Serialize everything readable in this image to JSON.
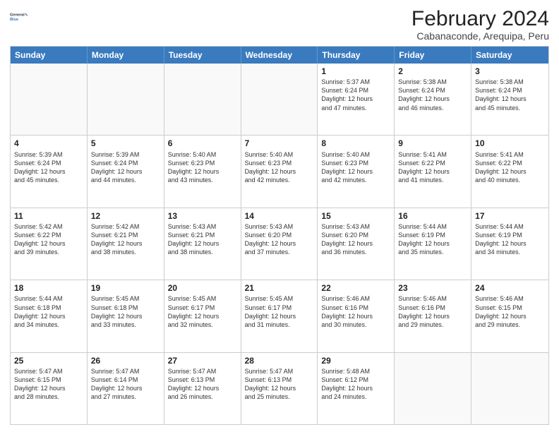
{
  "header": {
    "title": "February 2024",
    "subtitle": "Cabanaconde, Arequipa, Peru",
    "logo_general": "General",
    "logo_blue": "Blue"
  },
  "days_of_week": [
    "Sunday",
    "Monday",
    "Tuesday",
    "Wednesday",
    "Thursday",
    "Friday",
    "Saturday"
  ],
  "weeks": [
    [
      {
        "day": "",
        "text": "",
        "empty": true
      },
      {
        "day": "",
        "text": "",
        "empty": true
      },
      {
        "day": "",
        "text": "",
        "empty": true
      },
      {
        "day": "",
        "text": "",
        "empty": true
      },
      {
        "day": "1",
        "text": "Sunrise: 5:37 AM\nSunset: 6:24 PM\nDaylight: 12 hours\nand 47 minutes.",
        "empty": false
      },
      {
        "day": "2",
        "text": "Sunrise: 5:38 AM\nSunset: 6:24 PM\nDaylight: 12 hours\nand 46 minutes.",
        "empty": false
      },
      {
        "day": "3",
        "text": "Sunrise: 5:38 AM\nSunset: 6:24 PM\nDaylight: 12 hours\nand 45 minutes.",
        "empty": false
      }
    ],
    [
      {
        "day": "4",
        "text": "Sunrise: 5:39 AM\nSunset: 6:24 PM\nDaylight: 12 hours\nand 45 minutes.",
        "empty": false
      },
      {
        "day": "5",
        "text": "Sunrise: 5:39 AM\nSunset: 6:24 PM\nDaylight: 12 hours\nand 44 minutes.",
        "empty": false
      },
      {
        "day": "6",
        "text": "Sunrise: 5:40 AM\nSunset: 6:23 PM\nDaylight: 12 hours\nand 43 minutes.",
        "empty": false
      },
      {
        "day": "7",
        "text": "Sunrise: 5:40 AM\nSunset: 6:23 PM\nDaylight: 12 hours\nand 42 minutes.",
        "empty": false
      },
      {
        "day": "8",
        "text": "Sunrise: 5:40 AM\nSunset: 6:23 PM\nDaylight: 12 hours\nand 42 minutes.",
        "empty": false
      },
      {
        "day": "9",
        "text": "Sunrise: 5:41 AM\nSunset: 6:22 PM\nDaylight: 12 hours\nand 41 minutes.",
        "empty": false
      },
      {
        "day": "10",
        "text": "Sunrise: 5:41 AM\nSunset: 6:22 PM\nDaylight: 12 hours\nand 40 minutes.",
        "empty": false
      }
    ],
    [
      {
        "day": "11",
        "text": "Sunrise: 5:42 AM\nSunset: 6:22 PM\nDaylight: 12 hours\nand 39 minutes.",
        "empty": false
      },
      {
        "day": "12",
        "text": "Sunrise: 5:42 AM\nSunset: 6:21 PM\nDaylight: 12 hours\nand 38 minutes.",
        "empty": false
      },
      {
        "day": "13",
        "text": "Sunrise: 5:43 AM\nSunset: 6:21 PM\nDaylight: 12 hours\nand 38 minutes.",
        "empty": false
      },
      {
        "day": "14",
        "text": "Sunrise: 5:43 AM\nSunset: 6:20 PM\nDaylight: 12 hours\nand 37 minutes.",
        "empty": false
      },
      {
        "day": "15",
        "text": "Sunrise: 5:43 AM\nSunset: 6:20 PM\nDaylight: 12 hours\nand 36 minutes.",
        "empty": false
      },
      {
        "day": "16",
        "text": "Sunrise: 5:44 AM\nSunset: 6:19 PM\nDaylight: 12 hours\nand 35 minutes.",
        "empty": false
      },
      {
        "day": "17",
        "text": "Sunrise: 5:44 AM\nSunset: 6:19 PM\nDaylight: 12 hours\nand 34 minutes.",
        "empty": false
      }
    ],
    [
      {
        "day": "18",
        "text": "Sunrise: 5:44 AM\nSunset: 6:18 PM\nDaylight: 12 hours\nand 34 minutes.",
        "empty": false
      },
      {
        "day": "19",
        "text": "Sunrise: 5:45 AM\nSunset: 6:18 PM\nDaylight: 12 hours\nand 33 minutes.",
        "empty": false
      },
      {
        "day": "20",
        "text": "Sunrise: 5:45 AM\nSunset: 6:17 PM\nDaylight: 12 hours\nand 32 minutes.",
        "empty": false
      },
      {
        "day": "21",
        "text": "Sunrise: 5:45 AM\nSunset: 6:17 PM\nDaylight: 12 hours\nand 31 minutes.",
        "empty": false
      },
      {
        "day": "22",
        "text": "Sunrise: 5:46 AM\nSunset: 6:16 PM\nDaylight: 12 hours\nand 30 minutes.",
        "empty": false
      },
      {
        "day": "23",
        "text": "Sunrise: 5:46 AM\nSunset: 6:16 PM\nDaylight: 12 hours\nand 29 minutes.",
        "empty": false
      },
      {
        "day": "24",
        "text": "Sunrise: 5:46 AM\nSunset: 6:15 PM\nDaylight: 12 hours\nand 29 minutes.",
        "empty": false
      }
    ],
    [
      {
        "day": "25",
        "text": "Sunrise: 5:47 AM\nSunset: 6:15 PM\nDaylight: 12 hours\nand 28 minutes.",
        "empty": false
      },
      {
        "day": "26",
        "text": "Sunrise: 5:47 AM\nSunset: 6:14 PM\nDaylight: 12 hours\nand 27 minutes.",
        "empty": false
      },
      {
        "day": "27",
        "text": "Sunrise: 5:47 AM\nSunset: 6:13 PM\nDaylight: 12 hours\nand 26 minutes.",
        "empty": false
      },
      {
        "day": "28",
        "text": "Sunrise: 5:47 AM\nSunset: 6:13 PM\nDaylight: 12 hours\nand 25 minutes.",
        "empty": false
      },
      {
        "day": "29",
        "text": "Sunrise: 5:48 AM\nSunset: 6:12 PM\nDaylight: 12 hours\nand 24 minutes.",
        "empty": false
      },
      {
        "day": "",
        "text": "",
        "empty": true
      },
      {
        "day": "",
        "text": "",
        "empty": true
      }
    ]
  ]
}
